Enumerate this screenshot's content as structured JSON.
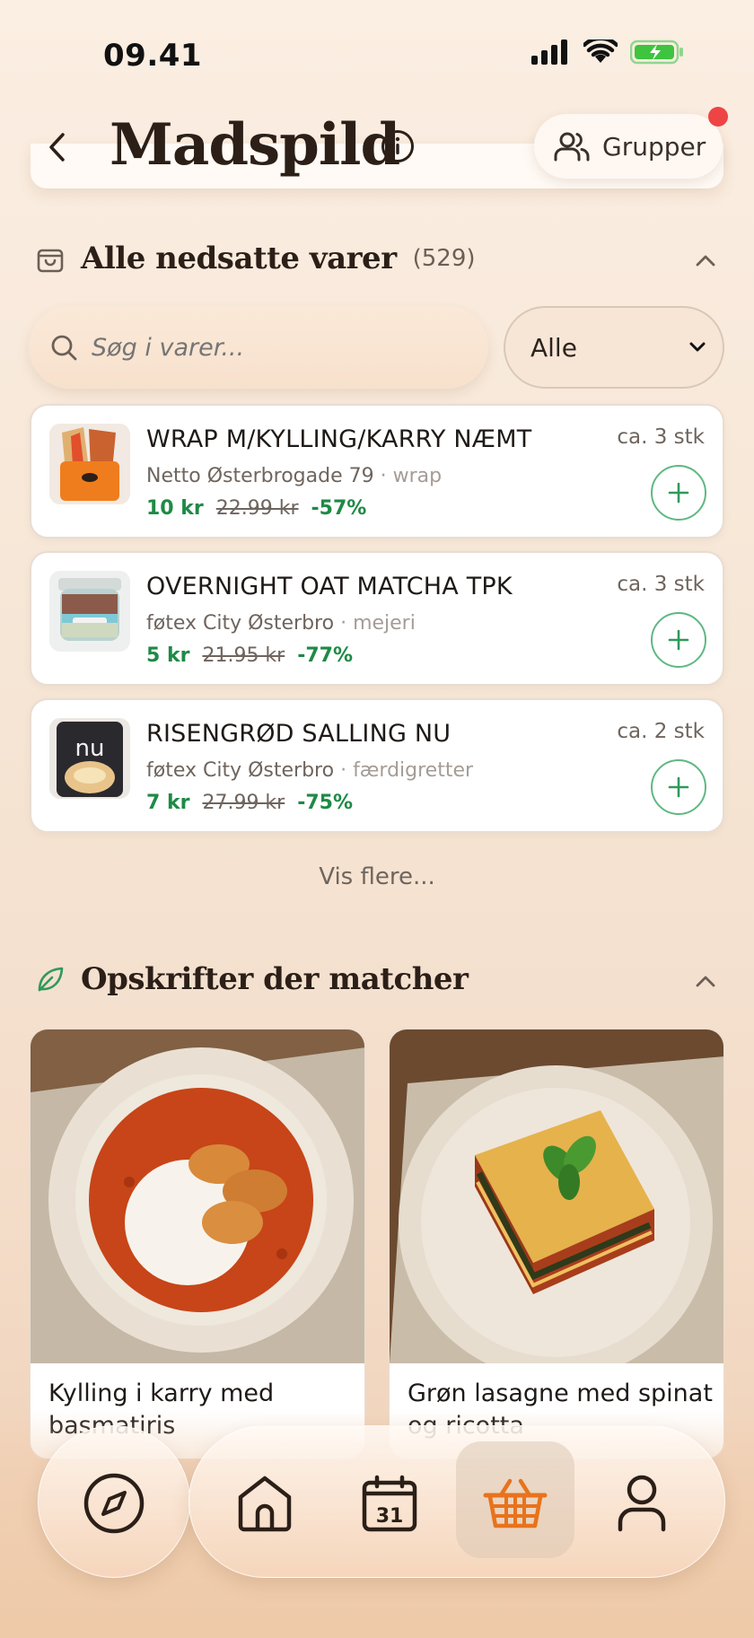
{
  "status": {
    "time": "09.41"
  },
  "header": {
    "title": "Madspild",
    "groups_label": "Grupper"
  },
  "sale": {
    "title": "Alle nedsatte varer",
    "count": "(529)",
    "search_placeholder": "Søg i varer...",
    "filter_value": "Alle",
    "items": [
      {
        "name": "WRAP M/KYLLING/KARRY NÆMT",
        "store": "Netto Østerbrogade 79",
        "category": "wrap",
        "price_new": "10 kr",
        "price_old": "22.99 kr",
        "discount": "-57%",
        "qty": "ca. 3 stk"
      },
      {
        "name": "OVERNIGHT OAT MATCHA TPK",
        "store": "føtex City Østerbro",
        "category": "mejeri",
        "price_new": "5 kr",
        "price_old": "21.95 kr",
        "discount": "-77%",
        "qty": "ca. 3 stk"
      },
      {
        "name": "RISENGRØD SALLING NU",
        "store": "føtex City Østerbro",
        "category": "færdigretter",
        "price_new": "7 kr",
        "price_old": "27.99 kr",
        "discount": "-75%",
        "qty": "ca. 2 stk"
      }
    ],
    "show_more": "Vis flere..."
  },
  "recipes": {
    "title": "Opskrifter der matcher",
    "items": [
      {
        "title": "Kylling i karry med basmatiris"
      },
      {
        "title": "Grøn lasagne med spinat og ricotta"
      }
    ]
  },
  "tabbar": {
    "calendar_day": "31"
  },
  "colors": {
    "accent_green": "#1e8a46",
    "active_tab": "#e8731c",
    "badge_red": "#ee4444"
  }
}
